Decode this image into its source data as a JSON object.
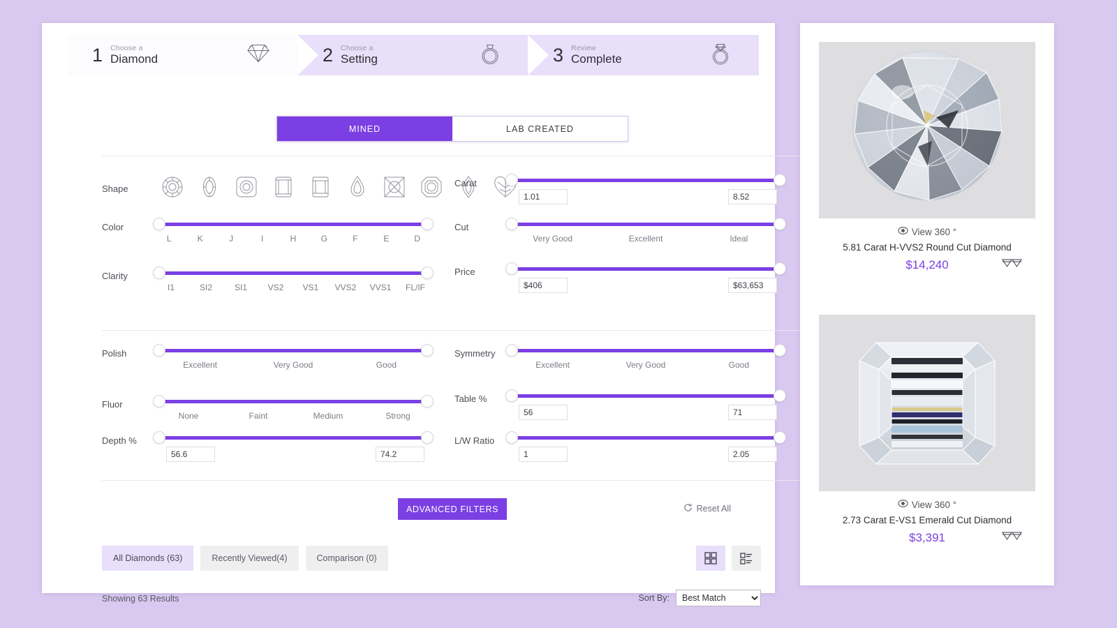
{
  "theme": {
    "accent": "#7b3fe4",
    "accent_light": "#e8dffb",
    "page_bg": "#d9c8ef"
  },
  "stepper": [
    {
      "num": "1",
      "sub": "Choose a",
      "main": "Diamond",
      "icon": "diamond-icon",
      "state": "active"
    },
    {
      "num": "2",
      "sub": "Choose a",
      "main": "Setting",
      "icon": "ring-icon",
      "state": "upcoming"
    },
    {
      "num": "3",
      "sub": "Review",
      "main": "Complete",
      "icon": "engagement-ring-icon",
      "state": "upcoming"
    }
  ],
  "origin_toggle": {
    "options": [
      "MINED",
      "LAB CREATED"
    ],
    "selected": "MINED"
  },
  "shape_filter": {
    "label": "Shape",
    "shapes": [
      "Round",
      "Oval",
      "Cushion",
      "Emerald",
      "Radiant",
      "Pear",
      "Princess",
      "Asscher",
      "Marquise",
      "Heart"
    ]
  },
  "filters_primary": [
    {
      "label": "Color",
      "type": "ticks",
      "ticks": [
        "L",
        "K",
        "J",
        "I",
        "H",
        "G",
        "F",
        "E",
        "D"
      ]
    },
    {
      "label": "Clarity",
      "type": "ticks",
      "ticks": [
        "I1",
        "SI2",
        "SI1",
        "VS2",
        "VS1",
        "VVS2",
        "VVS1",
        "FL/IF"
      ]
    },
    {
      "label": "Carat",
      "type": "numeric",
      "min_value": "1.01",
      "max_value": "8.52"
    },
    {
      "label": "Cut",
      "type": "ticks",
      "ticks": [
        "Very Good",
        "Excellent",
        "Ideal"
      ]
    },
    {
      "label": "Price",
      "type": "numeric",
      "min_value": "$406",
      "max_value": "$63,653"
    }
  ],
  "filters_secondary": [
    {
      "label": "Polish",
      "type": "ticks",
      "ticks": [
        "Excellent",
        "Very Good",
        "Good"
      ]
    },
    {
      "label": "Symmetry",
      "type": "ticks",
      "ticks": [
        "Excellent",
        "Very Good",
        "Good"
      ]
    },
    {
      "label": "Fluor",
      "type": "ticks",
      "ticks": [
        "None",
        "Faint",
        "Medium",
        "Strong"
      ]
    },
    {
      "label": "Table %",
      "type": "numeric",
      "min_value": "56",
      "max_value": "71"
    },
    {
      "label": "Depth %",
      "type": "numeric",
      "min_value": "56.6",
      "max_value": "74.2"
    },
    {
      "label": "L/W Ratio",
      "type": "numeric",
      "min_value": "1",
      "max_value": "2.05"
    }
  ],
  "actions": {
    "advanced_filters_label": "ADVANCED FILTERS",
    "reset_all_label": "Reset All",
    "reset_icon": "refresh-icon"
  },
  "result_tabs": [
    {
      "label": "All Diamonds (63)",
      "active": true
    },
    {
      "label": "Recently Viewed(4)",
      "active": false
    },
    {
      "label": "Comparison (0)",
      "active": false
    }
  ],
  "view_modes": [
    {
      "name": "grid-view",
      "active": true
    },
    {
      "name": "list-view",
      "active": false
    }
  ],
  "results": {
    "showing_text": "Showing 63 Results",
    "sort_label": "Sort By:",
    "sort_selected": "Best Match",
    "sort_options": [
      "Best Match"
    ]
  },
  "products": [
    {
      "view360_label": "View 360 °",
      "view360_icon": "eye-icon",
      "title": "5.81 Carat H-VVS2 Round Cut Diamond",
      "price": "$14,240",
      "shape": "round",
      "compare_icon": "compare-diamonds-icon"
    },
    {
      "view360_label": "View 360 °",
      "view360_icon": "eye-icon",
      "title": "2.73 Carat E-VS1 Emerald Cut Diamond",
      "price": "$3,391",
      "shape": "emerald",
      "compare_icon": "compare-diamonds-icon"
    }
  ]
}
